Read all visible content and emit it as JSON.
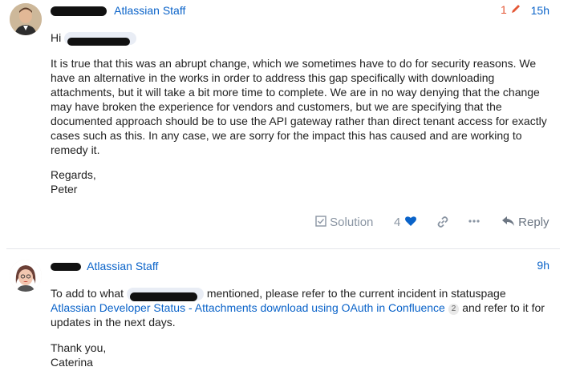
{
  "posts": [
    {
      "role": "Atlassian Staff",
      "edits": "1",
      "time": "15h",
      "greeting": "Hi",
      "body_para1": "It is true that this was an abrupt change, which we sometimes have to do for security reasons. We have an alternative in the works in order to address this gap specifically with downloading attachments, but it will take a bit more time to complete. We are in no way denying that the change may have broken the experience for vendors and customers, but we are specifying that the documented approach should be to use the API gateway rather than direct tenant access for exactly cases such as this. In any case, we are sorry for the impact this has caused and are working to remedy it.",
      "signoff": "Regards,",
      "signature": "Peter",
      "actions": {
        "solution_label": "Solution",
        "like_count": "4",
        "reply_label": "Reply"
      }
    },
    {
      "role": "Atlassian Staff",
      "time": "9h",
      "text_before": "To add to what",
      "text_mid": "mentioned, please refer to the current incident in statuspage",
      "link_text": "Atlassian Developer Status - Attachments download using OAuth in Confluence",
      "link_count": "2",
      "text_after": "and refer to it for updates in the next days.",
      "signoff": "Thank you,",
      "signature": "Caterina"
    }
  ]
}
